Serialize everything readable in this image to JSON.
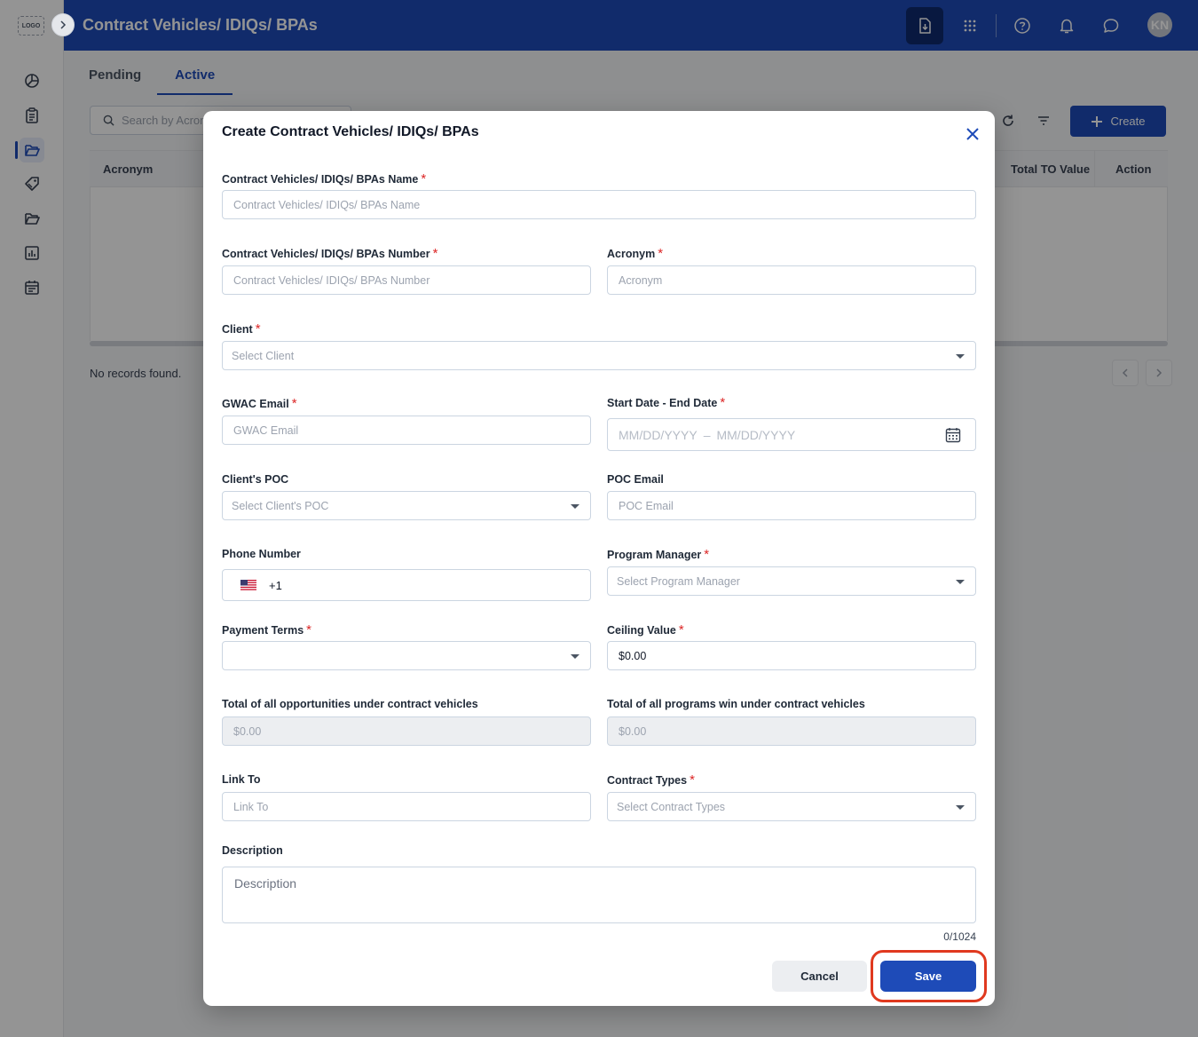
{
  "app": {
    "logo_text": "LOGO",
    "header_title": "Contract Vehicles/ IDIQs/ BPAs",
    "avatar_initials": "KN"
  },
  "tabs": [
    {
      "label": "Pending",
      "active": false
    },
    {
      "label": "Active",
      "active": true
    }
  ],
  "toolbar": {
    "search_placeholder": "Search by Acronym",
    "create_label": "Create"
  },
  "table": {
    "columns": [
      "Acronym",
      "Total TO Value",
      "Action"
    ],
    "empty_text": "No records found."
  },
  "modal": {
    "title": "Create Contract Vehicles/ IDIQs/ BPAs",
    "fields": {
      "name": {
        "label": "Contract Vehicles/ IDIQs/ BPAs Name",
        "placeholder": "Contract Vehicles/ IDIQs/ BPAs Name",
        "required": true
      },
      "number": {
        "label": "Contract Vehicles/ IDIQs/ BPAs Number",
        "placeholder": "Contract Vehicles/ IDIQs/ BPAs Number",
        "required": true
      },
      "acronym": {
        "label": "Acronym",
        "placeholder": "Acronym",
        "required": true
      },
      "client": {
        "label": "Client",
        "placeholder": "Select Client",
        "required": true
      },
      "gwac_email": {
        "label": "GWAC Email",
        "placeholder": "GWAC Email",
        "required": true
      },
      "dates": {
        "label": "Start Date - End Date",
        "start_placeholder": "MM/DD/YYYY",
        "separator": "–",
        "end_placeholder": "MM/DD/YYYY",
        "required": true
      },
      "client_poc": {
        "label": "Client's POC",
        "placeholder": "Select Client's POC"
      },
      "poc_email": {
        "label": "POC Email",
        "placeholder": "POC Email"
      },
      "phone": {
        "label": "Phone Number",
        "country_code": "+1"
      },
      "program_manager": {
        "label": "Program Manager",
        "placeholder": "Select Program Manager",
        "required": true
      },
      "payment_terms": {
        "label": "Payment Terms",
        "value": "",
        "required": true
      },
      "ceiling_value": {
        "label": "Ceiling Value",
        "value": "$0.00",
        "required": true
      },
      "total_opportunities": {
        "label": "Total of all opportunities under contract vehicles",
        "value": "$0.00"
      },
      "total_programs": {
        "label": "Total of all programs win under contract vehicles",
        "value": "$0.00"
      },
      "link_to": {
        "label": "Link To",
        "placeholder": "Link To"
      },
      "contract_types": {
        "label": "Contract Types",
        "placeholder": "Select Contract Types",
        "required": true
      },
      "description": {
        "label": "Description",
        "placeholder": "Description",
        "counter": "0/1024"
      }
    },
    "cancel_label": "Cancel",
    "save_label": "Save"
  },
  "colors": {
    "primary": "#1e4bb8",
    "required": "#dc2626",
    "highlight": "#e0391f"
  }
}
